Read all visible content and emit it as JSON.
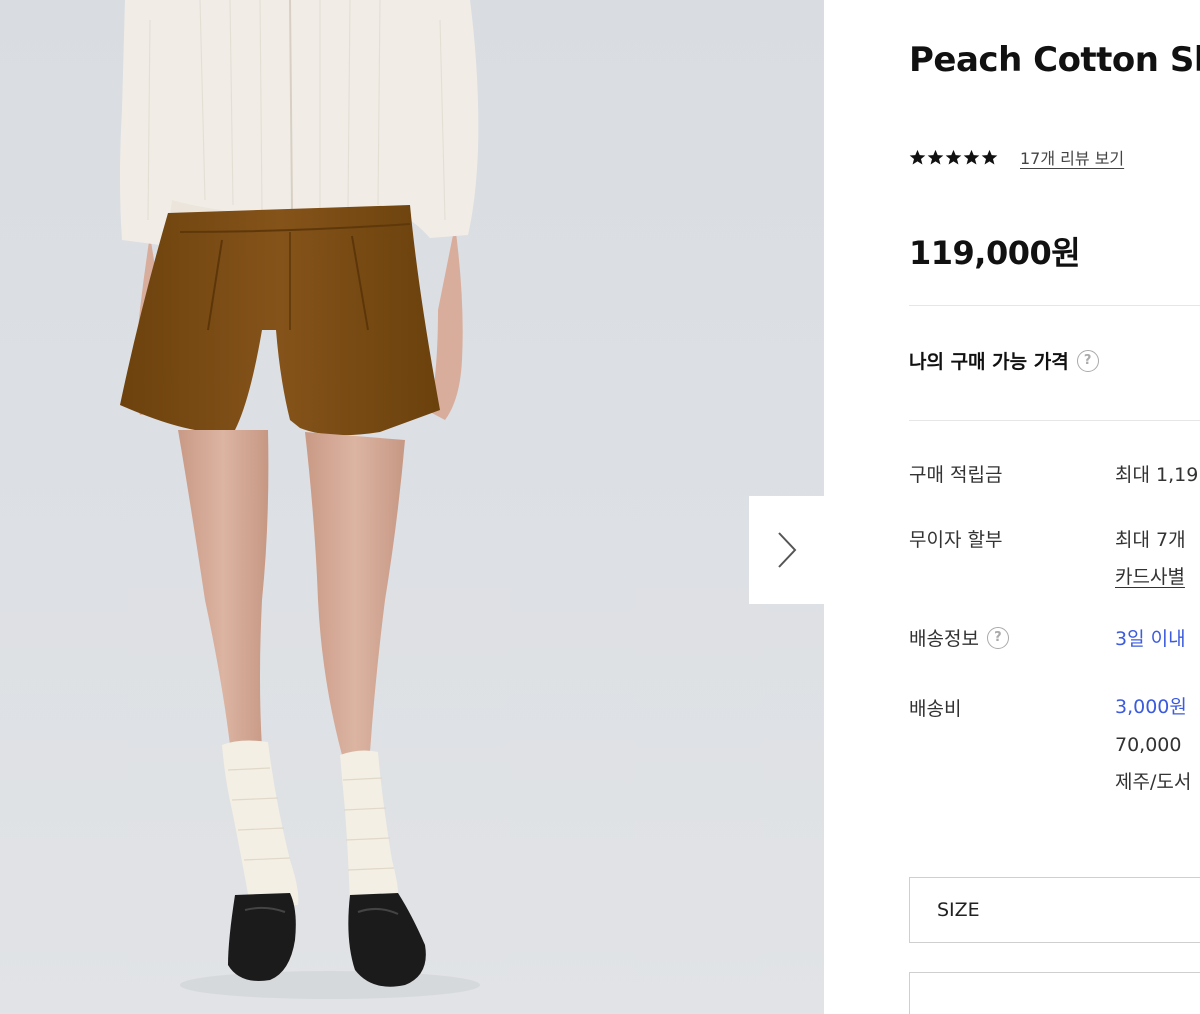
{
  "product": {
    "title": "Peach Cotton Sh",
    "rating_stars": 5,
    "review_link": "17개 리뷰 보기",
    "price": "119,000원"
  },
  "gallery": {
    "next_icon": "chevron-right-icon"
  },
  "my_price": {
    "label": "나의 구매 가능 가격",
    "help_icon": "?"
  },
  "details": {
    "points_label": "구매 적립금",
    "points_value": "최대 1,19",
    "installment_label": "무이자 할부",
    "installment_value": "최대 7개",
    "installment_link": "카드사별",
    "shipping_label": "배송정보",
    "shipping_help": "?",
    "shipping_value": "3일 이내",
    "fee_label": "배송비",
    "fee_line1": "3,000원",
    "fee_line2": "70,000",
    "fee_line3": "제주/도서"
  },
  "options": {
    "size_label": "SIZE"
  },
  "colors": {
    "link_blue": "#3c5bdd",
    "divider": "#e6e6e6",
    "shorts_brown": "#7a4b10"
  }
}
